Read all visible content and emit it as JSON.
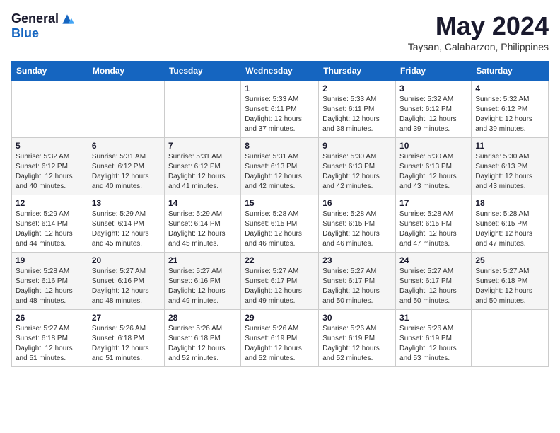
{
  "logo": {
    "general": "General",
    "blue": "Blue"
  },
  "title": {
    "month_year": "May 2024",
    "location": "Taysan, Calabarzon, Philippines"
  },
  "headers": [
    "Sunday",
    "Monday",
    "Tuesday",
    "Wednesday",
    "Thursday",
    "Friday",
    "Saturday"
  ],
  "weeks": [
    [
      {
        "day": "",
        "sunrise": "",
        "sunset": "",
        "daylight": ""
      },
      {
        "day": "",
        "sunrise": "",
        "sunset": "",
        "daylight": ""
      },
      {
        "day": "",
        "sunrise": "",
        "sunset": "",
        "daylight": ""
      },
      {
        "day": "1",
        "sunrise": "Sunrise: 5:33 AM",
        "sunset": "Sunset: 6:11 PM",
        "daylight": "Daylight: 12 hours and 37 minutes."
      },
      {
        "day": "2",
        "sunrise": "Sunrise: 5:33 AM",
        "sunset": "Sunset: 6:11 PM",
        "daylight": "Daylight: 12 hours and 38 minutes."
      },
      {
        "day": "3",
        "sunrise": "Sunrise: 5:32 AM",
        "sunset": "Sunset: 6:12 PM",
        "daylight": "Daylight: 12 hours and 39 minutes."
      },
      {
        "day": "4",
        "sunrise": "Sunrise: 5:32 AM",
        "sunset": "Sunset: 6:12 PM",
        "daylight": "Daylight: 12 hours and 39 minutes."
      }
    ],
    [
      {
        "day": "5",
        "sunrise": "Sunrise: 5:32 AM",
        "sunset": "Sunset: 6:12 PM",
        "daylight": "Daylight: 12 hours and 40 minutes."
      },
      {
        "day": "6",
        "sunrise": "Sunrise: 5:31 AM",
        "sunset": "Sunset: 6:12 PM",
        "daylight": "Daylight: 12 hours and 40 minutes."
      },
      {
        "day": "7",
        "sunrise": "Sunrise: 5:31 AM",
        "sunset": "Sunset: 6:12 PM",
        "daylight": "Daylight: 12 hours and 41 minutes."
      },
      {
        "day": "8",
        "sunrise": "Sunrise: 5:31 AM",
        "sunset": "Sunset: 6:13 PM",
        "daylight": "Daylight: 12 hours and 42 minutes."
      },
      {
        "day": "9",
        "sunrise": "Sunrise: 5:30 AM",
        "sunset": "Sunset: 6:13 PM",
        "daylight": "Daylight: 12 hours and 42 minutes."
      },
      {
        "day": "10",
        "sunrise": "Sunrise: 5:30 AM",
        "sunset": "Sunset: 6:13 PM",
        "daylight": "Daylight: 12 hours and 43 minutes."
      },
      {
        "day": "11",
        "sunrise": "Sunrise: 5:30 AM",
        "sunset": "Sunset: 6:13 PM",
        "daylight": "Daylight: 12 hours and 43 minutes."
      }
    ],
    [
      {
        "day": "12",
        "sunrise": "Sunrise: 5:29 AM",
        "sunset": "Sunset: 6:14 PM",
        "daylight": "Daylight: 12 hours and 44 minutes."
      },
      {
        "day": "13",
        "sunrise": "Sunrise: 5:29 AM",
        "sunset": "Sunset: 6:14 PM",
        "daylight": "Daylight: 12 hours and 45 minutes."
      },
      {
        "day": "14",
        "sunrise": "Sunrise: 5:29 AM",
        "sunset": "Sunset: 6:14 PM",
        "daylight": "Daylight: 12 hours and 45 minutes."
      },
      {
        "day": "15",
        "sunrise": "Sunrise: 5:28 AM",
        "sunset": "Sunset: 6:15 PM",
        "daylight": "Daylight: 12 hours and 46 minutes."
      },
      {
        "day": "16",
        "sunrise": "Sunrise: 5:28 AM",
        "sunset": "Sunset: 6:15 PM",
        "daylight": "Daylight: 12 hours and 46 minutes."
      },
      {
        "day": "17",
        "sunrise": "Sunrise: 5:28 AM",
        "sunset": "Sunset: 6:15 PM",
        "daylight": "Daylight: 12 hours and 47 minutes."
      },
      {
        "day": "18",
        "sunrise": "Sunrise: 5:28 AM",
        "sunset": "Sunset: 6:15 PM",
        "daylight": "Daylight: 12 hours and 47 minutes."
      }
    ],
    [
      {
        "day": "19",
        "sunrise": "Sunrise: 5:28 AM",
        "sunset": "Sunset: 6:16 PM",
        "daylight": "Daylight: 12 hours and 48 minutes."
      },
      {
        "day": "20",
        "sunrise": "Sunrise: 5:27 AM",
        "sunset": "Sunset: 6:16 PM",
        "daylight": "Daylight: 12 hours and 48 minutes."
      },
      {
        "day": "21",
        "sunrise": "Sunrise: 5:27 AM",
        "sunset": "Sunset: 6:16 PM",
        "daylight": "Daylight: 12 hours and 49 minutes."
      },
      {
        "day": "22",
        "sunrise": "Sunrise: 5:27 AM",
        "sunset": "Sunset: 6:17 PM",
        "daylight": "Daylight: 12 hours and 49 minutes."
      },
      {
        "day": "23",
        "sunrise": "Sunrise: 5:27 AM",
        "sunset": "Sunset: 6:17 PM",
        "daylight": "Daylight: 12 hours and 50 minutes."
      },
      {
        "day": "24",
        "sunrise": "Sunrise: 5:27 AM",
        "sunset": "Sunset: 6:17 PM",
        "daylight": "Daylight: 12 hours and 50 minutes."
      },
      {
        "day": "25",
        "sunrise": "Sunrise: 5:27 AM",
        "sunset": "Sunset: 6:18 PM",
        "daylight": "Daylight: 12 hours and 50 minutes."
      }
    ],
    [
      {
        "day": "26",
        "sunrise": "Sunrise: 5:27 AM",
        "sunset": "Sunset: 6:18 PM",
        "daylight": "Daylight: 12 hours and 51 minutes."
      },
      {
        "day": "27",
        "sunrise": "Sunrise: 5:26 AM",
        "sunset": "Sunset: 6:18 PM",
        "daylight": "Daylight: 12 hours and 51 minutes."
      },
      {
        "day": "28",
        "sunrise": "Sunrise: 5:26 AM",
        "sunset": "Sunset: 6:18 PM",
        "daylight": "Daylight: 12 hours and 52 minutes."
      },
      {
        "day": "29",
        "sunrise": "Sunrise: 5:26 AM",
        "sunset": "Sunset: 6:19 PM",
        "daylight": "Daylight: 12 hours and 52 minutes."
      },
      {
        "day": "30",
        "sunrise": "Sunrise: 5:26 AM",
        "sunset": "Sunset: 6:19 PM",
        "daylight": "Daylight: 12 hours and 52 minutes."
      },
      {
        "day": "31",
        "sunrise": "Sunrise: 5:26 AM",
        "sunset": "Sunset: 6:19 PM",
        "daylight": "Daylight: 12 hours and 53 minutes."
      },
      {
        "day": "",
        "sunrise": "",
        "sunset": "",
        "daylight": ""
      }
    ]
  ]
}
